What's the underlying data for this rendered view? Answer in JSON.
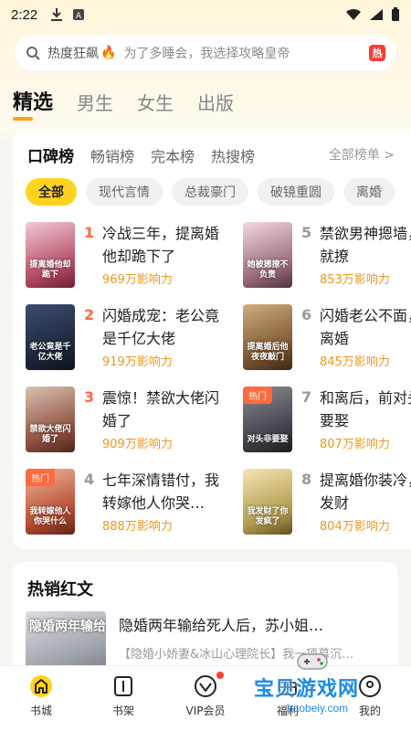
{
  "status_bar": {
    "time": "2:22"
  },
  "search": {
    "hot_label": "热度狂飙",
    "hint": "为了多睡会，我选择攻略皇帝",
    "badge": "热"
  },
  "top_tabs": [
    "精选",
    "男生",
    "女生",
    "出版"
  ],
  "ranking": {
    "tabs": [
      "口碑榜",
      "畅销榜",
      "完本榜",
      "热搜榜"
    ],
    "all_label": "全部榜单 >",
    "chips": [
      "全部",
      "现代言情",
      "总裁豪门",
      "破镜重圆",
      "离婚"
    ],
    "books": [
      {
        "rank": "1",
        "title": "冷战三年，提离婚他却跪下了",
        "impact": "969万影响力",
        "cover_text": "提离婚他却跪下",
        "hot": ""
      },
      {
        "rank": "2",
        "title": "闪婚成宠：老公竟是千亿大佬",
        "impact": "919万影响力",
        "cover_text": "老公竟是千亿大佬",
        "hot": ""
      },
      {
        "rank": "3",
        "title": "震惊！禁欲大佬闪婚了",
        "impact": "909万影响力",
        "cover_text": "禁欲大佬闪婚了",
        "hot": ""
      },
      {
        "rank": "4",
        "title": "七年深情错付，我转嫁他人你哭…",
        "impact": "888万影响力",
        "cover_text": "我转嫁他人你哭什么",
        "hot": "热门"
      },
      {
        "rank": "5",
        "title": "禁欲男神摁墙，她就撩",
        "impact": "853万影响力",
        "cover_text": "她被摁撩不负责",
        "hot": ""
      },
      {
        "rank": "6",
        "title": "闪婚老公不面，提离婚",
        "impact": "845万影响力",
        "cover_text": "提离婚后他夜夜敲门",
        "hot": ""
      },
      {
        "rank": "7",
        "title": "和离后，前对头非要娶",
        "impact": "807万影响力",
        "cover_text": "对头非要娶",
        "hot": "热门"
      },
      {
        "rank": "8",
        "title": "提离婚你装冷，我发财",
        "impact": "804万影响力",
        "cover_text": "我发财了你发疯了",
        "hot": ""
      }
    ]
  },
  "hot_section": {
    "title": "热销红文",
    "book": {
      "title": "隐婚两年输给死人后，苏小姐…",
      "subtitle": "【隐婚小娇妻&冰山心理院长】我一项幕沉…",
      "cover_text": "隐婚两年输给"
    }
  },
  "bottom_nav": [
    {
      "label": "书城",
      "icon": "home-icon"
    },
    {
      "label": "书架",
      "icon": "bookshelf-icon"
    },
    {
      "label": "VIP会员",
      "icon": "vip-diamond-icon"
    },
    {
      "label": "福利",
      "icon": "gift-icon"
    },
    {
      "label": "我的",
      "icon": "profile-icon"
    }
  ],
  "watermark": {
    "text": "宝贝游戏网",
    "url": "baobeiy.com"
  },
  "colors": {
    "accent": "#ffd21f",
    "impact": "#f0961c",
    "rank_top3": "#ff6a3d",
    "rank_other": "#999999"
  }
}
